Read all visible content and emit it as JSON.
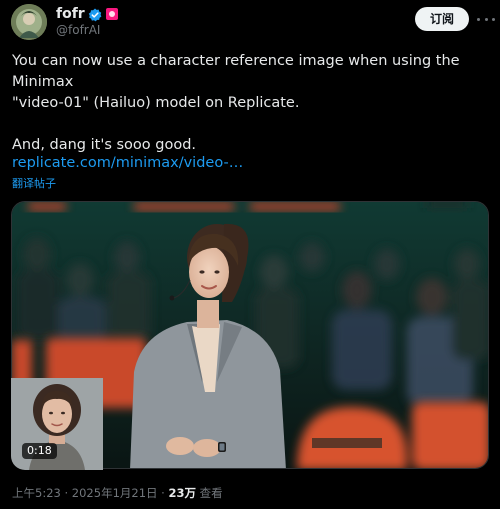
{
  "author": {
    "display_name": "fofr",
    "handle": "@fofrAI",
    "verified": true,
    "verified_color": "#1d9bf0",
    "affiliate_badge_color": "#f91880"
  },
  "header": {
    "subscribe_label": "订阅",
    "more_icon": "more-dots-icon"
  },
  "tweet": {
    "lines": [
      "You can now use a character reference image when using the Minimax",
      "\"video-01\" (Hailuo) model on Replicate."
    ],
    "second_paragraph": "And, dang it's sooo good.",
    "link_text": "replicate.com/minimax/video-…",
    "translate_label": "翻译帖子",
    "link_color": "#1d9bf0"
  },
  "media": {
    "type": "video",
    "duration": "0:18"
  },
  "meta": {
    "time": "上午5:23",
    "separator": "·",
    "date": "2025年1月21日",
    "views_count": "23万",
    "views_label": "查看"
  }
}
